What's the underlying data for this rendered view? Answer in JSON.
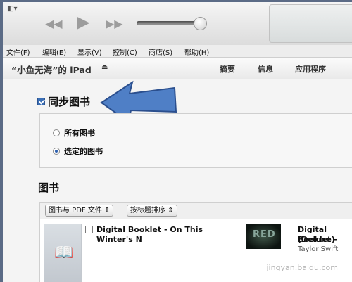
{
  "toolbar": {
    "view_glyph": "◧▾",
    "rewind_icon": "◀◀",
    "play_icon": "▶",
    "forward_icon": "▶▶"
  },
  "menu": [
    "文件(F)",
    "编辑(E)",
    "显示(V)",
    "控制(C)",
    "商店(S)",
    "帮助(H)"
  ],
  "device": {
    "name": "“小鱼无海”的 iPad",
    "eject_glyph": "⏏",
    "tabs": [
      "摘要",
      "信息",
      "应用程序"
    ]
  },
  "sync": {
    "label": "同步图书",
    "checked": true,
    "options": [
      {
        "label": "所有图书",
        "selected": false
      },
      {
        "label": "选定的图书",
        "selected": true
      }
    ]
  },
  "books": {
    "title": "图书",
    "filter_label": "图书与 PDF 文件 ⇕",
    "sort_label": "按标题排序 ⇕",
    "items": [
      {
        "title_line1": "Digital Booklet - On This",
        "title_line2": "Winter's N",
        "artist": ""
      },
      {
        "title_line1": "Digital Booklet -",
        "title_line2": "(Deluxe)",
        "artist": "Taylor Swift",
        "cover_text": "RED"
      }
    ]
  },
  "watermark": "jingyan.baidu.com",
  "colors": {
    "accent": "#3b6fb6",
    "arrow_fill": "#4f7fc6",
    "arrow_stroke": "#2b4f8e"
  }
}
